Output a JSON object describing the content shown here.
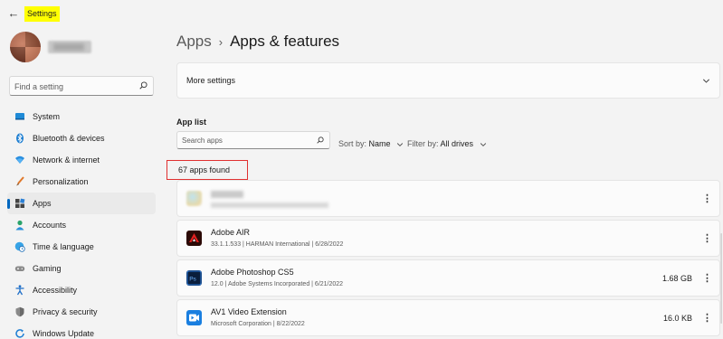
{
  "window": {
    "title": "Settings"
  },
  "search": {
    "placeholder": "Find a setting"
  },
  "nav": [
    {
      "label": "System",
      "icon": "monitor-icon",
      "active": false
    },
    {
      "label": "Bluetooth & devices",
      "icon": "bluetooth-icon",
      "active": false
    },
    {
      "label": "Network & internet",
      "icon": "wifi-icon",
      "active": false
    },
    {
      "label": "Personalization",
      "icon": "brush-icon",
      "active": false
    },
    {
      "label": "Apps",
      "icon": "apps-icon",
      "active": true
    },
    {
      "label": "Accounts",
      "icon": "person-icon",
      "active": false
    },
    {
      "label": "Time & language",
      "icon": "globe-clock-icon",
      "active": false
    },
    {
      "label": "Gaming",
      "icon": "gamepad-icon",
      "active": false
    },
    {
      "label": "Accessibility",
      "icon": "accessibility-icon",
      "active": false
    },
    {
      "label": "Privacy & security",
      "icon": "shield-icon",
      "active": false
    },
    {
      "label": "Windows Update",
      "icon": "update-icon",
      "active": false
    }
  ],
  "breadcrumb": {
    "parent": "Apps",
    "separator": "›",
    "current": "Apps & features"
  },
  "more_settings": {
    "label": "More settings"
  },
  "app_list": {
    "label": "App list",
    "search_placeholder": "Search apps",
    "sort_label": "Sort by:",
    "sort_value": "Name",
    "filter_label": "Filter by:",
    "filter_value": "All drives",
    "count_text": "67 apps found"
  },
  "apps": [
    {
      "name": "",
      "meta": "",
      "size": "",
      "icon": "blurred-app-icon",
      "blurred": true
    },
    {
      "name": "Adobe AIR",
      "meta": "33.1.1.533  |  HARMAN International  |  6/28/2022",
      "size": "",
      "icon": "adobe-air-icon"
    },
    {
      "name": "Adobe Photoshop CS5",
      "meta": "12.0  |  Adobe Systems Incorporated  |  6/21/2022",
      "size": "1.68 GB",
      "icon": "photoshop-icon"
    },
    {
      "name": "AV1 Video Extension",
      "meta": "Microsoft Corporation  |  8/22/2022",
      "size": "16.0 KB",
      "icon": "av1-extension-icon"
    }
  ],
  "colors": {
    "accent": "#0067c0",
    "highlight": "#ffff00",
    "callout_border": "#e03030"
  }
}
